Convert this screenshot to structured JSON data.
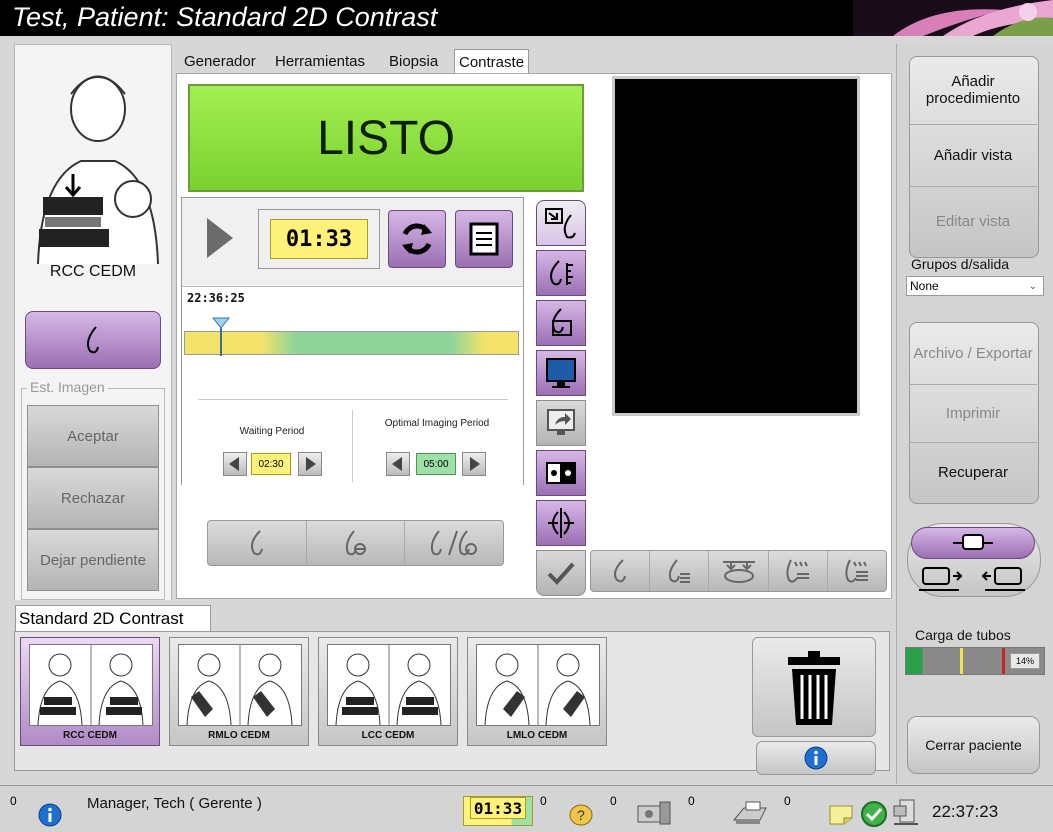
{
  "title": "Test, Patient:  Standard 2D Contrast",
  "left": {
    "view_label": "RCC CEDM",
    "est_group": "Est. Imagen",
    "accept": "Aceptar",
    "reject": "Rechazar",
    "pending": "Dejar pendiente"
  },
  "tabs": [
    "Generador",
    "Herramientas",
    "Biopsia",
    "Contraste"
  ],
  "status": {
    "ready": "LISTO"
  },
  "timer": {
    "countdown": "01:33",
    "clock": "22:36:25",
    "waiting_label": "Waiting Period",
    "waiting_value": "02:30",
    "optimal_label": "Optimal Imaging Period",
    "optimal_value": "05:00"
  },
  "right": {
    "add_procedure": "Añadir procedimiento",
    "add_view": "Añadir vista",
    "edit_view": "Editar vista",
    "output_groups_label": "Grupos d/salida",
    "output_groups_value": "None",
    "archive": "Archivo / Exportar",
    "print": "Imprimir",
    "retrieve": "Recuperar",
    "tube_load_label": "Carga de tubos",
    "tube_load_pct": "14%",
    "close_patient": "Cerrar paciente"
  },
  "procedure": {
    "name": "Standard 2D Contrast",
    "thumbs": [
      "RCC CEDM",
      "RMLO CEDM",
      "LCC CEDM",
      "LMLO CEDM"
    ]
  },
  "statusbar": {
    "count_left": "0",
    "user": "Manager, Tech ( Gerente )",
    "timer": "01:33",
    "c1": "0",
    "c2": "0",
    "c3": "0",
    "c4": "0",
    "time": "22:37:23"
  },
  "colors": {
    "ready_green": "#8fe03a",
    "timer_yellow": "#fff27a",
    "accent_purple": "#a57cc0"
  }
}
